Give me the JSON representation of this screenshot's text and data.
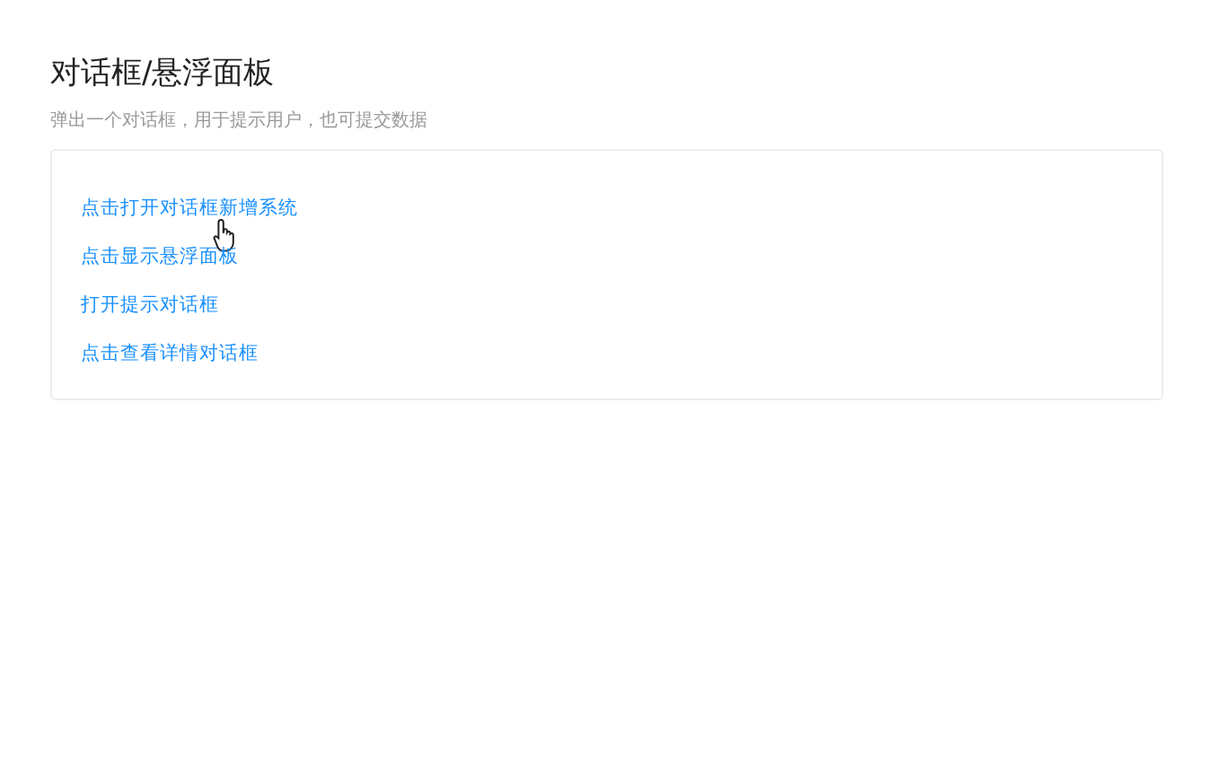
{
  "page": {
    "title": "对话框/悬浮面板",
    "subtitle": "弹出一个对话框，用于提示用户，也可提交数据"
  },
  "links": [
    {
      "label": "点击打开对话框新增系统",
      "hovered": true
    },
    {
      "label": "点击显示悬浮面板",
      "hovered": false
    },
    {
      "label": "打开提示对话框",
      "hovered": false
    },
    {
      "label": "点击查看详情对话框",
      "hovered": false
    }
  ]
}
